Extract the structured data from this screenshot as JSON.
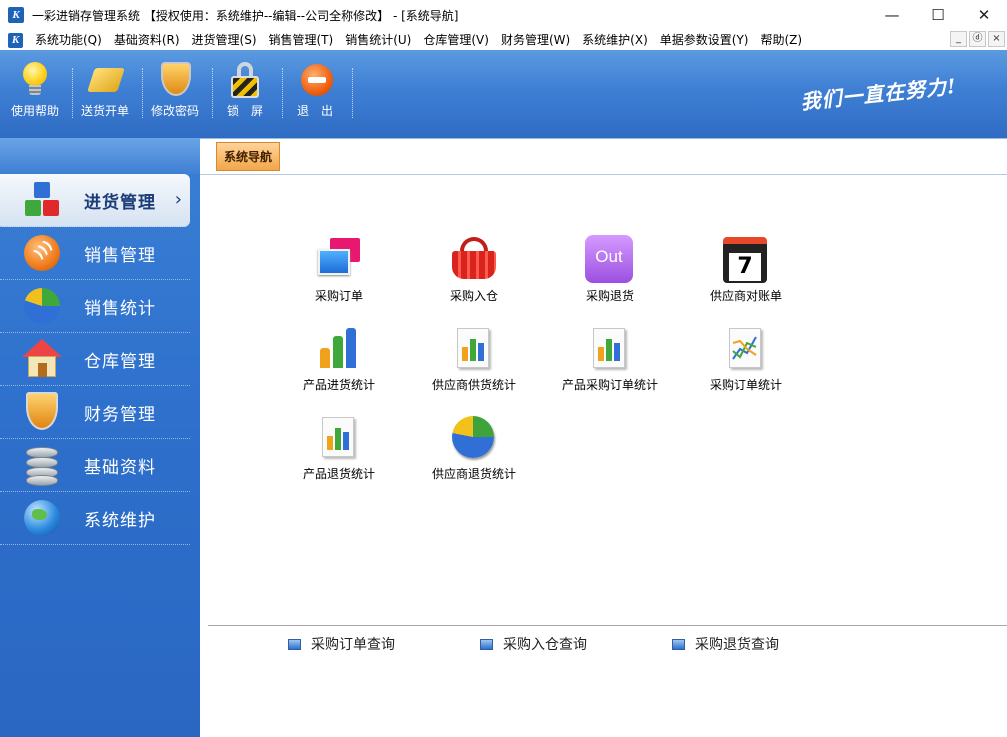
{
  "window": {
    "title": "一彩进销存管理系统 【授权使用：系统维护--编辑--公司全称修改】 - [系统导航]",
    "logo_text": "K",
    "controls": {
      "minimize": "—",
      "maximize": "☐",
      "close": "✕"
    }
  },
  "menubar": {
    "items": [
      "系统功能(Q)",
      "基础资料(R)",
      "进货管理(S)",
      "销售管理(T)",
      "销售统计(U)",
      "仓库管理(V)",
      "财务管理(W)",
      "系统维护(X)",
      "单据参数设置(Y)",
      "帮助(Z)"
    ],
    "mdi": {
      "minimize": "_",
      "restore": "ⓓ",
      "close": "×"
    }
  },
  "toolbar": {
    "buttons": [
      {
        "label": "使用帮助",
        "icon": "lightbulb-icon"
      },
      {
        "label": "送货开单",
        "icon": "pen-icon"
      },
      {
        "label": "修改密码",
        "icon": "shield-icon"
      },
      {
        "label": "锁　屏",
        "icon": "lock-icon"
      },
      {
        "label": "退　出",
        "icon": "exit-icon"
      }
    ],
    "slogan": "我们一直在努力!"
  },
  "sidebar": {
    "items": [
      {
        "label": "进货管理",
        "icon": "cubes-icon",
        "active": true
      },
      {
        "label": "销售管理",
        "icon": "rss-icon"
      },
      {
        "label": "销售统计",
        "icon": "pie-chart-icon"
      },
      {
        "label": "仓库管理",
        "icon": "house-icon"
      },
      {
        "label": "财务管理",
        "icon": "shield-icon"
      },
      {
        "label": "基础资料",
        "icon": "database-icon"
      },
      {
        "label": "系统维护",
        "icon": "globe-icon"
      }
    ],
    "arrow": "›"
  },
  "content": {
    "tab": "系统导航",
    "grid": [
      {
        "label": "采购订单",
        "icon": "windows-icon"
      },
      {
        "label": "采购入仓",
        "icon": "basket-icon"
      },
      {
        "label": "采购退货",
        "icon": "out-icon",
        "icon_text": "Out"
      },
      {
        "label": "供应商对账单",
        "icon": "calendar-icon",
        "icon_text": "7"
      },
      {
        "label": "产品进货统计",
        "icon": "bar-chart-icon"
      },
      {
        "label": "供应商供货统计",
        "icon": "report-chart-icon"
      },
      {
        "label": "产品采购订单统计",
        "icon": "report-chart-icon"
      },
      {
        "label": "采购订单统计",
        "icon": "line-chart-icon"
      },
      {
        "label": "产品退货统计",
        "icon": "report-chart-icon"
      },
      {
        "label": "供应商退货统计",
        "icon": "pie-chart-icon"
      }
    ],
    "queries": [
      "采购订单查询",
      "采购入仓查询",
      "采购退货查询"
    ]
  }
}
